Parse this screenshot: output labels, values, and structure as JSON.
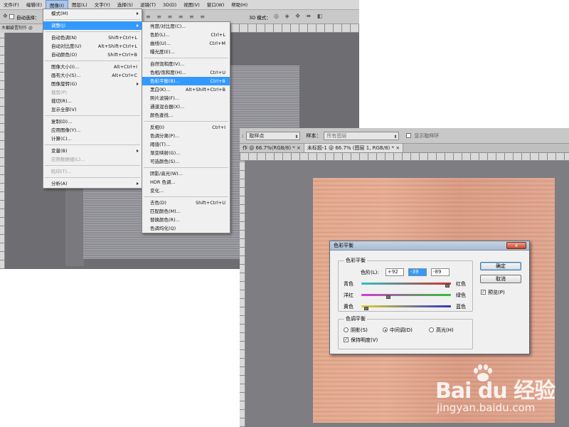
{
  "shotA": {
    "menubar": [
      "文件(F)",
      "编辑(E)",
      "图像(I)",
      "图层(L)",
      "文字(Y)",
      "选择(S)",
      "滤镜(T)",
      "3D(D)",
      "视图(V)",
      "窗口(W)",
      "帮助(H)"
    ],
    "active_menu": "图像(I)",
    "optbar_label": "自动选择：",
    "optbar_3d": "3D 模式：",
    "doc_tab": "木板设置制作 @",
    "ruler_label": "150",
    "image_menu": [
      {
        "label": "模式(M)",
        "shortcut": "",
        "submenu": true
      },
      {
        "sep": true
      },
      {
        "label": "调整(J)",
        "shortcut": "",
        "submenu": true,
        "highlight": true
      },
      {
        "sep": true
      },
      {
        "label": "自动色调(N)",
        "shortcut": "Shift+Ctrl+L"
      },
      {
        "label": "自动对比度(U)",
        "shortcut": "Alt+Shift+Ctrl+L"
      },
      {
        "label": "自动颜色(O)",
        "shortcut": "Shift+Ctrl+B"
      },
      {
        "sep": true
      },
      {
        "label": "图像大小(I)...",
        "shortcut": "Alt+Ctrl+I"
      },
      {
        "label": "画布大小(S)...",
        "shortcut": "Alt+Ctrl+C"
      },
      {
        "label": "图像旋转(G)",
        "shortcut": "",
        "submenu": true
      },
      {
        "label": "裁剪(P)",
        "shortcut": "",
        "disabled": true
      },
      {
        "label": "裁切(R)...",
        "shortcut": ""
      },
      {
        "label": "显示全部(V)",
        "shortcut": ""
      },
      {
        "sep": true
      },
      {
        "label": "复制(D)...",
        "shortcut": ""
      },
      {
        "label": "应用图像(Y)...",
        "shortcut": ""
      },
      {
        "label": "计算(C)...",
        "shortcut": ""
      },
      {
        "sep": true
      },
      {
        "label": "变量(B)",
        "shortcut": "",
        "submenu": true
      },
      {
        "label": "应用数据组(L)...",
        "shortcut": "",
        "disabled": true
      },
      {
        "sep": true
      },
      {
        "label": "陷印(T)...",
        "shortcut": "",
        "disabled": true
      },
      {
        "sep": true
      },
      {
        "label": "分析(A)",
        "shortcut": "",
        "submenu": true
      }
    ],
    "adjust_menu": [
      {
        "label": "亮度/对比度(C)...",
        "shortcut": ""
      },
      {
        "label": "色阶(L)...",
        "shortcut": "Ctrl+L"
      },
      {
        "label": "曲线(U)...",
        "shortcut": "Ctrl+M"
      },
      {
        "label": "曝光度(E)...",
        "shortcut": ""
      },
      {
        "sep": true
      },
      {
        "label": "自然饱和度(V)...",
        "shortcut": ""
      },
      {
        "label": "色相/饱和度(H)...",
        "shortcut": "Ctrl+U"
      },
      {
        "label": "色彩平衡(B)...",
        "shortcut": "Ctrl+B",
        "highlight": true
      },
      {
        "label": "黑白(K)...",
        "shortcut": "Alt+Shift+Ctrl+B"
      },
      {
        "label": "照片滤镜(F)...",
        "shortcut": ""
      },
      {
        "label": "通道混合器(X)...",
        "shortcut": ""
      },
      {
        "label": "颜色查找...",
        "shortcut": ""
      },
      {
        "sep": true
      },
      {
        "label": "反相(I)",
        "shortcut": "Ctrl+I"
      },
      {
        "label": "色调分离(P)...",
        "shortcut": ""
      },
      {
        "label": "阈值(T)...",
        "shortcut": ""
      },
      {
        "label": "渐变映射(G)...",
        "shortcut": ""
      },
      {
        "label": "可选颜色(S)...",
        "shortcut": ""
      },
      {
        "sep": true
      },
      {
        "label": "阴影/高光(W)...",
        "shortcut": ""
      },
      {
        "label": "HDR 色调...",
        "shortcut": ""
      },
      {
        "label": "变化...",
        "shortcut": ""
      },
      {
        "sep": true
      },
      {
        "label": "去色(D)",
        "shortcut": "Shift+Ctrl+U"
      },
      {
        "label": "匹配颜色(M)...",
        "shortcut": ""
      },
      {
        "label": "替换颜色(R)...",
        "shortcut": ""
      },
      {
        "label": "色调均化(Q)",
        "shortcut": ""
      }
    ]
  },
  "shotB": {
    "optbar": {
      "sample_label": "取样点",
      "sample_size_label": "样本：",
      "sample_value": "所有图层",
      "show_ring": "显示取样环"
    },
    "tabs": [
      "作 @ 66.7%(RGB/8) *",
      "未标题-1 @ 66.7% (图层 1, RGB/8) *"
    ],
    "dialog": {
      "title": "色彩平衡",
      "close": "x",
      "group1": "色彩平衡",
      "levels_label": "色阶(L):",
      "levels": [
        "+92",
        "-39",
        "-89"
      ],
      "sliders": [
        {
          "left": "青色",
          "right": "红色",
          "value": 92,
          "track_from": "#29c3c9",
          "track_to": "#d62a2a"
        },
        {
          "left": "洋红",
          "right": "绿色",
          "value": -39,
          "track_from": "#d13ad1",
          "track_to": "#2fc235"
        },
        {
          "left": "黄色",
          "right": "蓝色",
          "value": -89,
          "track_from": "#e3d52e",
          "track_to": "#2a35c9"
        }
      ],
      "group2": "色调平衡",
      "tones": [
        {
          "label": "阴影(S)",
          "checked": false
        },
        {
          "label": "中间调(D)",
          "checked": true
        },
        {
          "label": "高光(H)",
          "checked": false
        }
      ],
      "preserve": "保持明度(V)",
      "ok": "确定",
      "cancel": "取消",
      "preview": "预览(P)"
    }
  },
  "watermark": {
    "brand": "Bai du 经验",
    "url": "jingyan.baidu.com"
  }
}
